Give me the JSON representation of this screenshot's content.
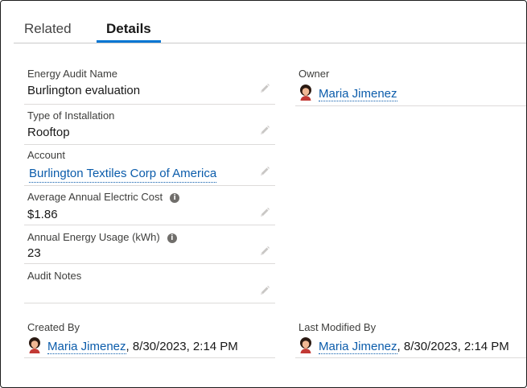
{
  "tabs": [
    {
      "label": "Related"
    },
    {
      "label": "Details"
    }
  ],
  "fields": {
    "energy_audit_name": {
      "label": "Energy Audit Name",
      "value": "Burlington evaluation"
    },
    "type_of_installation": {
      "label": "Type of Installation",
      "value": "Rooftop"
    },
    "account": {
      "label": "Account",
      "value": "Burlington Textiles Corp of America"
    },
    "avg_annual_electric_cost": {
      "label": "Average Annual Electric Cost",
      "value": "$1.86"
    },
    "annual_energy_usage": {
      "label": "Annual Energy Usage (kWh)",
      "value": "23"
    },
    "audit_notes": {
      "label": "Audit Notes",
      "value": ""
    },
    "owner": {
      "label": "Owner",
      "name": "Maria Jimenez"
    },
    "created_by": {
      "label": "Created By",
      "name": "Maria Jimenez",
      "meta": ", 8/30/2023, 2:14 PM"
    },
    "last_modified_by": {
      "label": "Last Modified By",
      "name": "Maria Jimenez",
      "meta": ", 8/30/2023, 2:14 PM"
    }
  },
  "colors": {
    "accent": "#0176d3",
    "link": "#0b5cab"
  },
  "icons": {
    "edit": "pencil-icon",
    "info": "info-icon",
    "avatar": "user-avatar"
  }
}
